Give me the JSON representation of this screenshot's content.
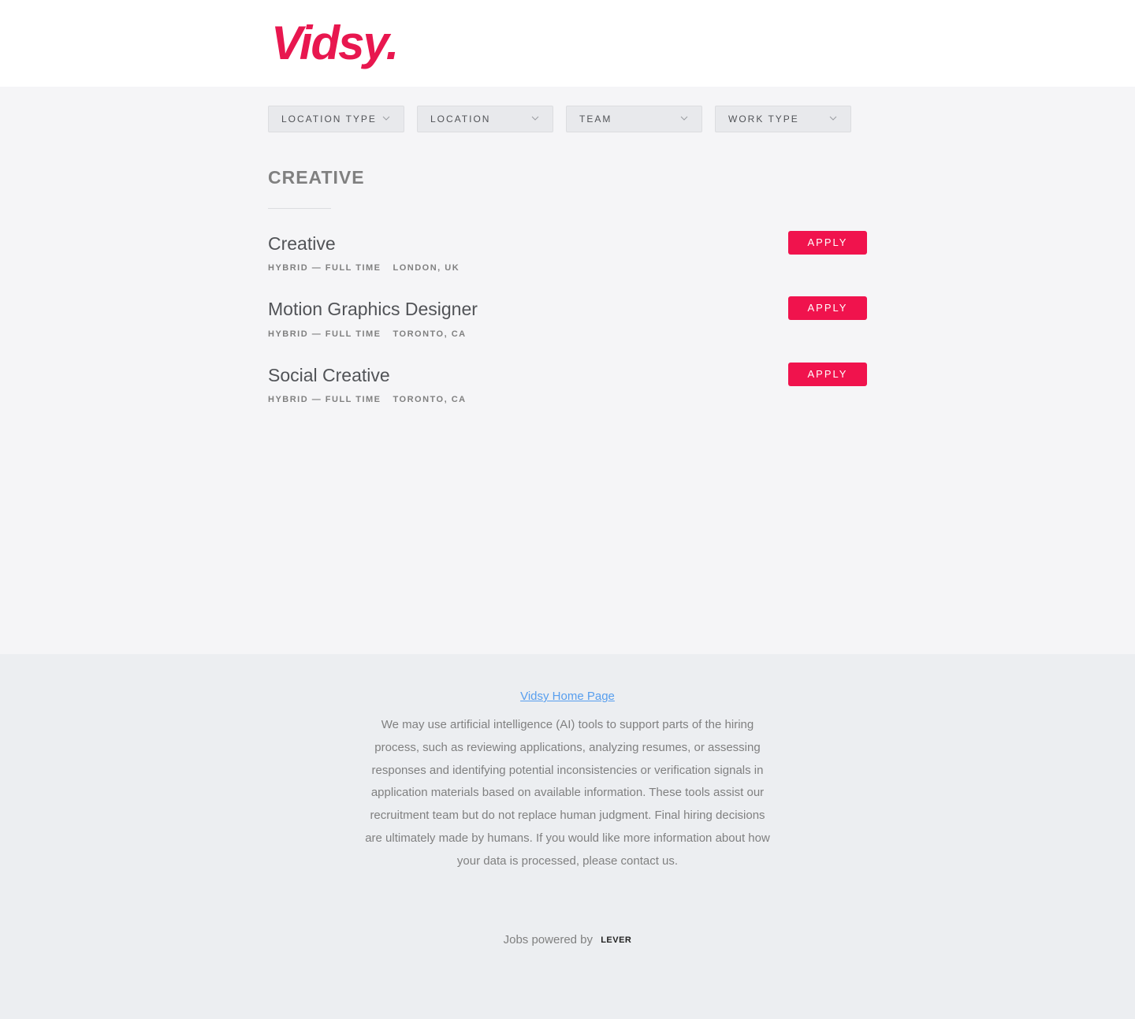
{
  "header": {
    "logo_text": "Vidsy.",
    "brand_color": "#e8174f"
  },
  "filters": [
    {
      "label": "LOCATION TYPE",
      "icon": "chevron-down-icon"
    },
    {
      "label": "LOCATION",
      "icon": "chevron-down-icon"
    },
    {
      "label": "TEAM",
      "icon": "chevron-down-icon"
    },
    {
      "label": "WORK TYPE",
      "icon": "chevron-down-icon"
    }
  ],
  "section": {
    "title": "CREATIVE"
  },
  "postings": [
    {
      "title": "Creative",
      "commitment": "HYBRID — FULL TIME",
      "location": "LONDON, UK",
      "apply_label": "APPLY"
    },
    {
      "title": "Motion Graphics Designer",
      "commitment": "HYBRID — FULL TIME",
      "location": "TORONTO, CA",
      "apply_label": "APPLY"
    },
    {
      "title": "Social Creative",
      "commitment": "HYBRID — FULL TIME",
      "location": "TORONTO, CA",
      "apply_label": "APPLY"
    }
  ],
  "apply_color": "#f0134d",
  "footer": {
    "home_link": "Vidsy Home Page",
    "disclaimer": "We may use artificial intelligence (AI) tools to support parts of the hiring process, such as reviewing applications, analyzing resumes, or assessing responses and identifying potential inconsistencies or verification signals in application materials based on available information. These tools assist our recruitment team but do not replace human judgment. Final hiring decisions are ultimately made by humans. If you would like more information about how your data is processed, please contact us.",
    "powered_by": "Jobs powered by",
    "lever_logo": "LEVER"
  }
}
